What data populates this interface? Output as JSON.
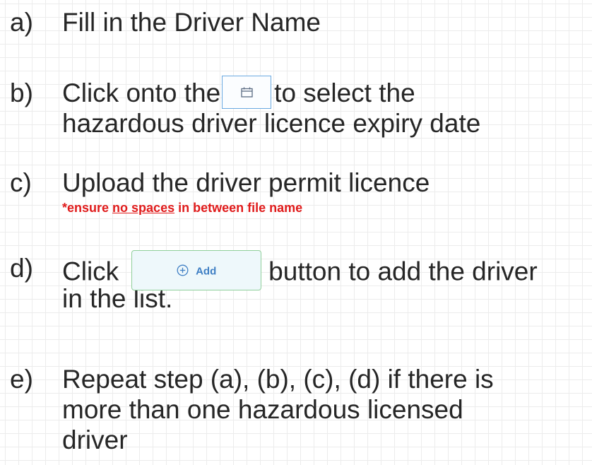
{
  "steps": [
    {
      "marker": "a)",
      "lines": [
        "Fill in the Driver Name"
      ]
    },
    {
      "marker": "b)",
      "line1_before": "Click onto the",
      "line1_after": "to select the",
      "line2": "hazardous driver licence expiry date"
    },
    {
      "marker": "c)",
      "line1": "Upload the driver permit licence",
      "note_before": "*ensure ",
      "note_underline": "no spaces",
      "note_after": " in between file name"
    },
    {
      "marker": "d)",
      "line1_before": "Click",
      "button_label": "Add",
      "line1_after": "button to add the driver",
      "line2": "in the list."
    },
    {
      "marker": "e)",
      "lines": [
        "Repeat step (a), (b), (c), (d) if there is",
        "more than one hazardous licensed",
        "driver"
      ]
    }
  ],
  "icons": {
    "calendar": "calendar-icon",
    "add": "plus-circle-icon"
  },
  "colors": {
    "text": "#262626",
    "note": "#e01b1b",
    "calendar_border": "#6aa9e0",
    "add_border": "#8fcf9a",
    "add_text": "#3f7fc4"
  }
}
